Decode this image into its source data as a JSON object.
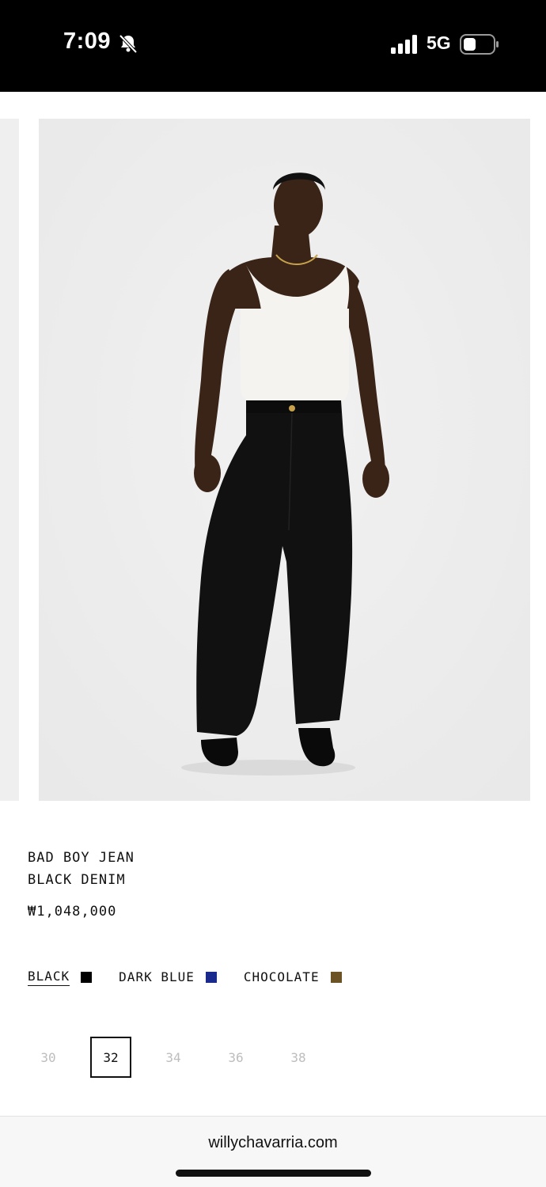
{
  "status_bar": {
    "time": "7:09",
    "network": "5G",
    "icons": [
      "bell-slash-icon",
      "signal-icon",
      "battery-icon"
    ]
  },
  "product": {
    "name_line1": "BAD BOY JEAN",
    "name_line2": "BLACK DENIM",
    "price": "₩1,048,000",
    "colors": [
      {
        "label": "BLACK",
        "swatch": "#000000",
        "selected": true
      },
      {
        "label": "DARK BLUE",
        "swatch": "#1a2a8c",
        "selected": false
      },
      {
        "label": "CHOCOLATE",
        "swatch": "#6b5325",
        "selected": false
      }
    ],
    "sizes": [
      {
        "label": "30",
        "selected": false
      },
      {
        "label": "32",
        "selected": true
      },
      {
        "label": "34",
        "selected": false
      },
      {
        "label": "36",
        "selected": false
      },
      {
        "label": "38",
        "selected": false
      }
    ]
  },
  "browser": {
    "url": "willychavarria.com"
  }
}
